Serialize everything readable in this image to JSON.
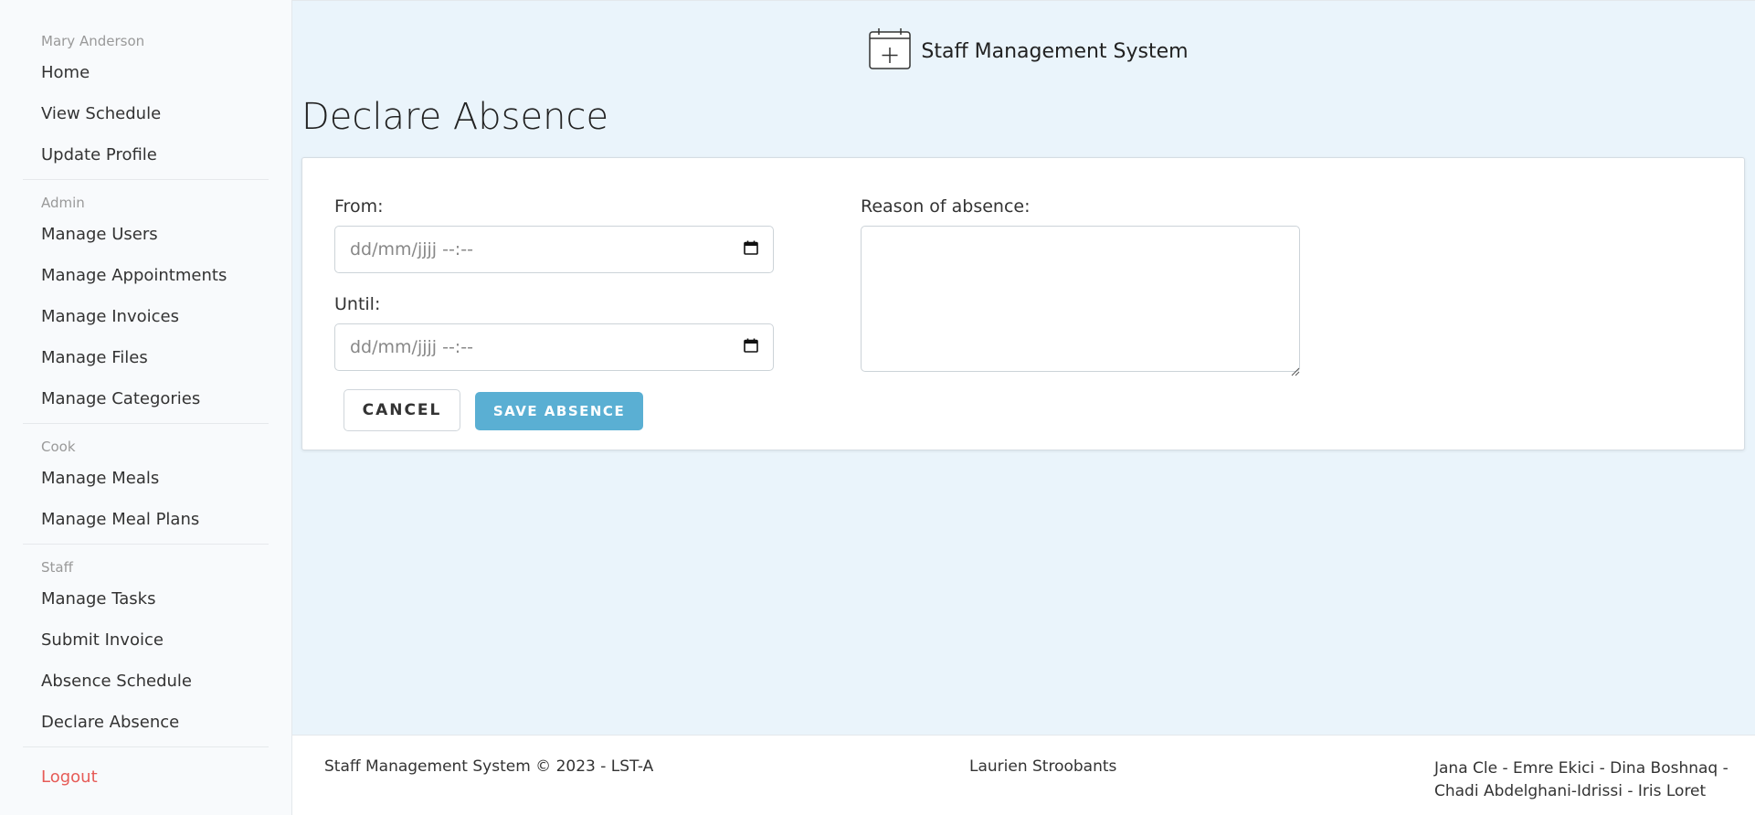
{
  "sidebar": {
    "user_name": "Mary Anderson",
    "user_items": [
      "Home",
      "View Schedule",
      "Update Profile"
    ],
    "admin_label": "Admin",
    "admin_items": [
      "Manage Users",
      "Manage Appointments",
      "Manage Invoices",
      "Manage Files",
      "Manage Categories"
    ],
    "cook_label": "Cook",
    "cook_items": [
      "Manage Meals",
      "Manage Meal Plans"
    ],
    "staff_label": "Staff",
    "staff_items": [
      "Manage Tasks",
      "Submit Invoice",
      "Absence Schedule",
      "Declare Absence"
    ],
    "logout": "Logout"
  },
  "header": {
    "title": "Staff Management System",
    "icon": "calendar-plus-icon"
  },
  "page": {
    "title": "Declare Absence"
  },
  "form": {
    "from_label": "From:",
    "from_placeholder": "dd/mm/jjjj --:--",
    "until_label": "Until:",
    "until_placeholder": "dd/mm/jjjj --:--",
    "reason_label": "Reason of absence:",
    "reason_value": "",
    "cancel_label": "CANCEL",
    "save_label": "SAVE ABSENCE"
  },
  "footer": {
    "left": "Staff Management System © 2023 - LST-A",
    "middle": "Laurien Stroobants",
    "right": "Jana Cle - Emre Ekici - Dina Boshnaq - Chadi Abdelghani-Idrissi - Iris Loret"
  },
  "colors": {
    "accent": "#5aafd3",
    "logout": "#e65b57",
    "background": "#eaf4fb"
  }
}
